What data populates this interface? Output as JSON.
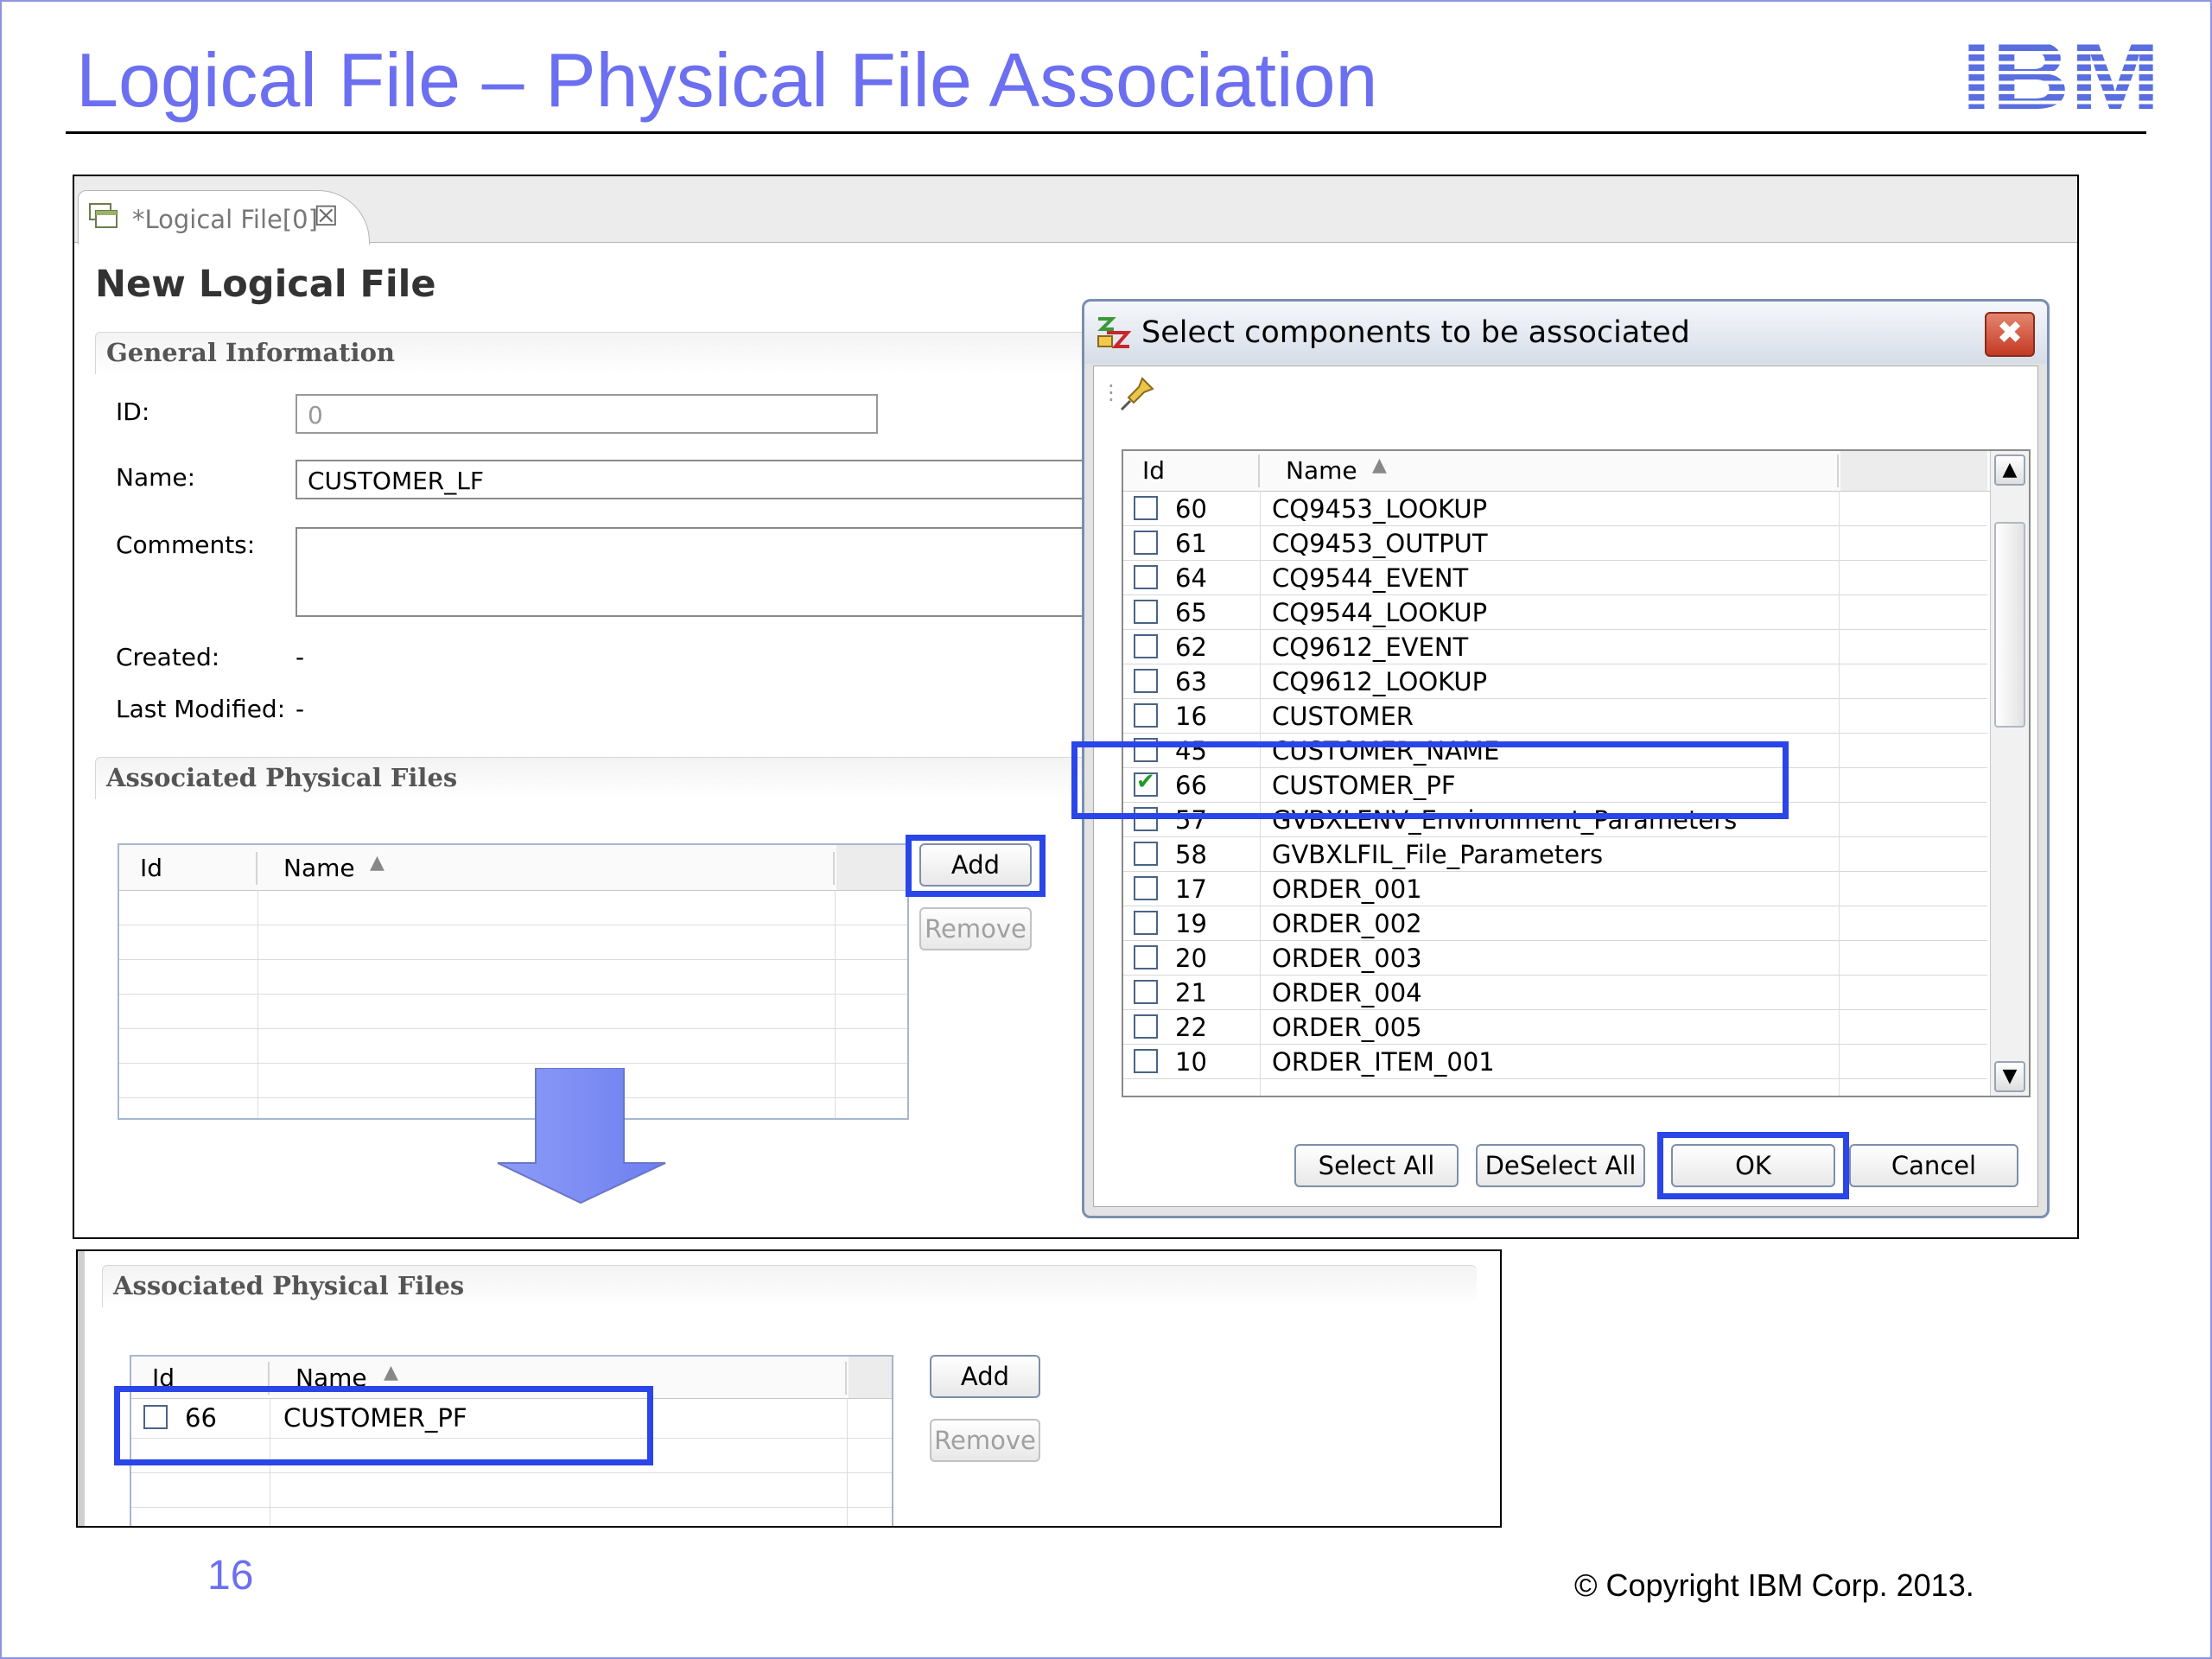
{
  "slide": {
    "title": "Logical File – Physical File Association",
    "logo_text": "IBM",
    "page_number": "16",
    "copyright": "© Copyright IBM Corp. 2013."
  },
  "editor": {
    "tab_label": "*Logical File[0]",
    "form_title": "New Logical File",
    "general_section": "General Information",
    "fields": {
      "id_label": "ID:",
      "id_value": "0",
      "name_label": "Name:",
      "name_value": "CUSTOMER_LF",
      "comments_label": "Comments:",
      "comments_value": "",
      "created_label": "Created:",
      "created_value": "-",
      "modified_label": "Last Modified:",
      "modified_value": "-"
    },
    "physical_section": "Associated Physical Files",
    "grid_headers": {
      "id": "Id",
      "name": "Name"
    },
    "add_label": "Add",
    "remove_label": "Remove"
  },
  "dialog": {
    "title": "Select components to be associated",
    "headers": {
      "id": "Id",
      "name": "Name"
    },
    "rows": [
      {
        "id": "60",
        "name": "CQ9453_LOOKUP",
        "checked": false
      },
      {
        "id": "61",
        "name": "CQ9453_OUTPUT",
        "checked": false
      },
      {
        "id": "64",
        "name": "CQ9544_EVENT",
        "checked": false
      },
      {
        "id": "65",
        "name": "CQ9544_LOOKUP",
        "checked": false
      },
      {
        "id": "62",
        "name": "CQ9612_EVENT",
        "checked": false
      },
      {
        "id": "63",
        "name": "CQ9612_LOOKUP",
        "checked": false
      },
      {
        "id": "16",
        "name": "CUSTOMER",
        "checked": false
      },
      {
        "id": "45",
        "name": "CUSTOMER_NAME",
        "checked": false
      },
      {
        "id": "66",
        "name": "CUSTOMER_PF",
        "checked": true
      },
      {
        "id": "57",
        "name": "GVBXLENV_Environment_Parameters",
        "checked": false
      },
      {
        "id": "58",
        "name": "GVBXLFIL_File_Parameters",
        "checked": false
      },
      {
        "id": "17",
        "name": "ORDER_001",
        "checked": false
      },
      {
        "id": "19",
        "name": "ORDER_002",
        "checked": false
      },
      {
        "id": "20",
        "name": "ORDER_003",
        "checked": false
      },
      {
        "id": "21",
        "name": "ORDER_004",
        "checked": false
      },
      {
        "id": "22",
        "name": "ORDER_005",
        "checked": false
      },
      {
        "id": "10",
        "name": "ORDER_ITEM_001",
        "checked": false
      }
    ],
    "buttons": {
      "select_all": "Select All",
      "deselect_all": "DeSelect All",
      "ok": "OK",
      "cancel": "Cancel"
    }
  },
  "result": {
    "section": "Associated Physical Files",
    "grid_headers": {
      "id": "Id",
      "name": "Name"
    },
    "row": {
      "id": "66",
      "name": "CUSTOMER_PF"
    },
    "add_label": "Add",
    "remove_label": "Remove"
  },
  "colors": {
    "title": "#6b6ff0",
    "highlight": "#2a45e8",
    "arrow": "#7b8cf5"
  }
}
